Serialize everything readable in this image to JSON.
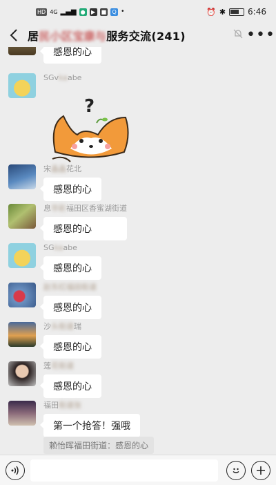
{
  "status_bar": {
    "network": [
      "HD",
      "4G"
    ],
    "time": "6:46"
  },
  "title_bar": {
    "title_prefix": "居",
    "title_blurred": "民小区宝康与",
    "title_suffix": "服务交流(241)"
  },
  "messages": [
    {
      "sender": "",
      "text": "感恩的心"
    },
    {
      "sender_visible": "SGv",
      "sender_blurred": "ka",
      "sender_tail": "abe",
      "text": ""
    },
    {
      "sender_visible": "宋",
      "sender_blurred": "晶晶",
      "sender_tail": "花北",
      "text": "感恩的心"
    },
    {
      "sender_visible": "息",
      "sender_blurred": "华彩",
      "sender_tail": "福田区香蜜湖街道",
      "text": "感恩的心"
    },
    {
      "sender_visible": "SG",
      "sender_blurred": "ka",
      "sender_tail": "abe",
      "text": "感恩的心"
    },
    {
      "sender_visible": "",
      "sender_blurred": "赵东红福田街道",
      "sender_tail": "",
      "text": "感恩的心"
    },
    {
      "sender_visible": "沙",
      "sender_blurred": "头街道",
      "sender_tail": "瑞",
      "text": "感恩的心"
    },
    {
      "sender_visible": "莲",
      "sender_blurred": "花街道",
      "sender_tail": "",
      "text": "感恩的心"
    },
    {
      "sender_visible": "福田",
      "sender_blurred": "街道张",
      "sender_tail": "",
      "text": "第一个抢答！强哦"
    }
  ],
  "quote": "赖怡晖福田街道：感恩的心",
  "input_bar": {
    "voice_icon": "voice-icon",
    "emoji_icon": "emoji-icon",
    "plus_icon": "plus-icon"
  }
}
